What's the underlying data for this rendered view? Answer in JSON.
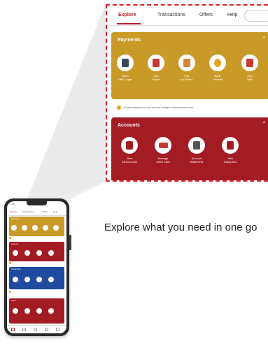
{
  "zoom": {
    "tabs": [
      {
        "label": "Explore",
        "active": true
      },
      {
        "label": "Transactions"
      },
      {
        "label": "Offers"
      },
      {
        "label": "Help"
      }
    ],
    "search_pill": "",
    "payments": {
      "title": "Payments",
      "color": "#c99a27",
      "items": [
        {
          "label": "Scan\nDBS Lugas",
          "icon": "qr-scan-icon"
        },
        {
          "label": "Add\nPayee",
          "icon": "add-payee-icon"
        },
        {
          "label": "Pay\nby Phone",
          "icon": "phone-pay-icon"
        },
        {
          "label": "Bank\nTransfer",
          "icon": "transfer-icon"
        },
        {
          "label": "Pay\nBills",
          "icon": "bills-icon"
        }
      ]
    },
    "info_text": "Avoid missing out and access multiple transactions here",
    "accounts": {
      "title": "Accounts",
      "color": "#a31c24",
      "items": [
        {
          "label": "View\nAll Accounts",
          "icon": "view-accounts-icon"
        },
        {
          "label": "Manage\nDebit Card",
          "icon": "debit-card-icon"
        },
        {
          "label": "Account\nStatement",
          "icon": "statement-icon"
        },
        {
          "label": "Add\nSalary Acc",
          "icon": "add-account-icon"
        }
      ]
    }
  },
  "caption": "Explore what you need in one go",
  "phone": {
    "status_time": "1:25",
    "tabs": [
      "Explore",
      "Transactions",
      "Offers",
      "Help"
    ],
    "sections": [
      {
        "title": "Payments",
        "color": "#c99a27"
      },
      {
        "title": "Accounts",
        "color": "#a31c24"
      },
      {
        "title": "Credit Cards",
        "color": "#1e4aa0"
      },
      {
        "title": "Loans",
        "color": "#a31c24"
      }
    ]
  },
  "colors": {
    "accent": "#b3202a",
    "gold": "#c99a27",
    "navy": "#1e4aa0"
  }
}
